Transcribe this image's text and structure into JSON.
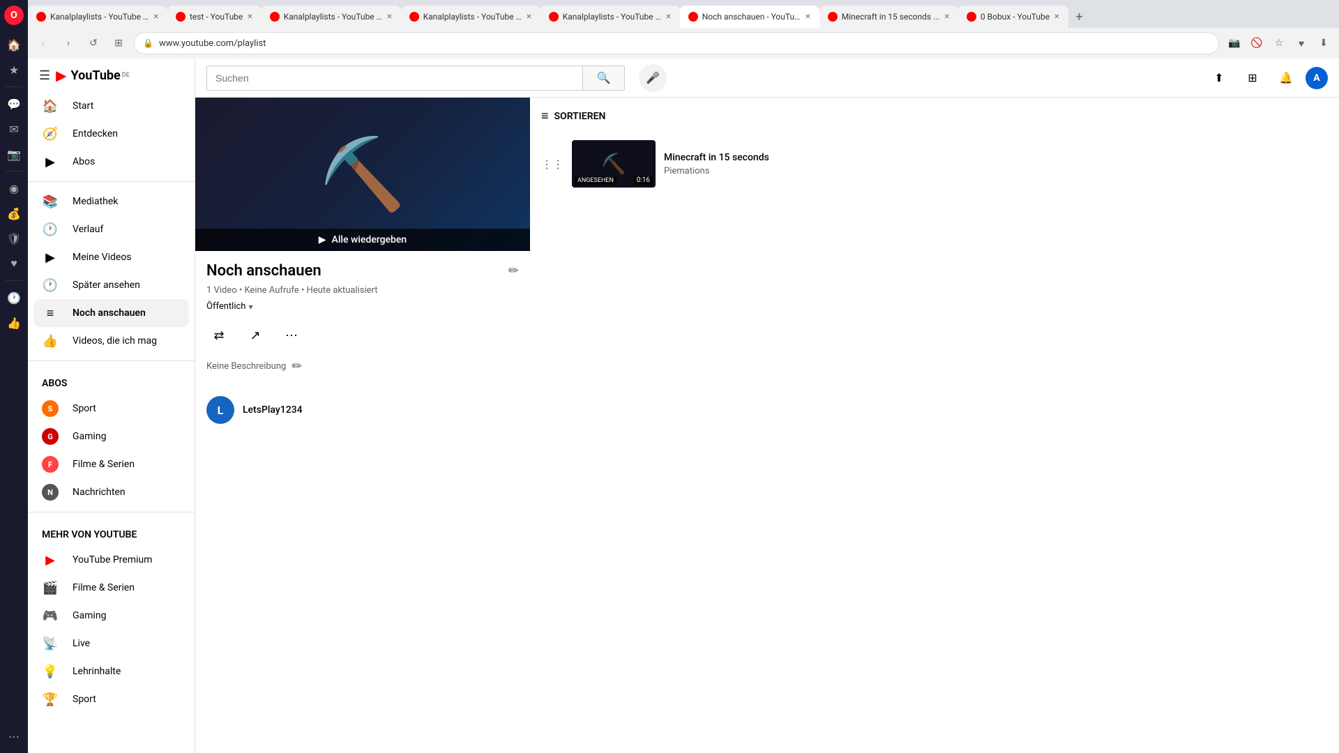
{
  "browser": {
    "tabs": [
      {
        "id": 1,
        "title": "Kanalplaylists - YouTube S...",
        "url": "youtube.com",
        "active": false,
        "favicon": "yt-red"
      },
      {
        "id": 2,
        "title": "test - YouTube",
        "url": "youtube.com",
        "active": false,
        "favicon": "yt-red"
      },
      {
        "id": 3,
        "title": "Kanalplaylists - YouTube S...",
        "url": "youtube.com",
        "active": false,
        "favicon": "yt-red"
      },
      {
        "id": 4,
        "title": "Kanalplaylists - YouTube S...",
        "url": "youtube.com",
        "active": false,
        "favicon": "yt-red"
      },
      {
        "id": 5,
        "title": "Kanalplaylists - YouTube S...",
        "url": "youtube.com",
        "active": false,
        "favicon": "yt-red"
      },
      {
        "id": 6,
        "title": "Noch anschauen - YouTube...",
        "url": "youtube.com",
        "active": true,
        "favicon": "yt-red"
      },
      {
        "id": 7,
        "title": "Minecraft in 15 seconds...",
        "url": "youtube.com",
        "active": false,
        "favicon": "yt-red"
      },
      {
        "id": 8,
        "title": "0 Bobux - YouTube",
        "url": "youtube.com",
        "active": false,
        "favicon": "yt-red"
      }
    ],
    "address": "www.youtube.com/playlist"
  },
  "youtube": {
    "logo_text": "YouTube",
    "logo_suffix": "DE",
    "search_placeholder": "Suchen",
    "sidebar": {
      "main_items": [
        {
          "id": "start",
          "label": "Start",
          "icon": "🏠"
        },
        {
          "id": "entdecken",
          "label": "Entdecken",
          "icon": "🧭"
        },
        {
          "id": "abos",
          "label": "Abos",
          "icon": "▶️"
        }
      ],
      "library_items": [
        {
          "id": "mediathek",
          "label": "Mediathek",
          "icon": "📚"
        },
        {
          "id": "verlauf",
          "label": "Verlauf",
          "icon": "🕐"
        },
        {
          "id": "meine-videos",
          "label": "Meine Videos",
          "icon": "▶"
        },
        {
          "id": "spaeter-ansehen",
          "label": "Später ansehen",
          "icon": "🕐"
        },
        {
          "id": "noch-anschauen",
          "label": "Noch anschauen",
          "icon": "≡",
          "active": true
        },
        {
          "id": "videos-ich-mag",
          "label": "Videos, die ich mag",
          "icon": "👍"
        }
      ],
      "abos_section_title": "ABOS",
      "abos_items": [
        {
          "id": "sport",
          "label": "Sport",
          "color": "#ff6b00"
        },
        {
          "id": "gaming",
          "label": "Gaming",
          "color": "#cc0000"
        },
        {
          "id": "filme-serien",
          "label": "Filme & Serien",
          "color": "#ff4444"
        },
        {
          "id": "nachrichten",
          "label": "Nachrichten",
          "color": "#444444"
        }
      ],
      "mehr_section_title": "MEHR VON YOUTUBE",
      "mehr_items": [
        {
          "id": "youtube-premium",
          "label": "YouTube Premium",
          "icon": "▶"
        },
        {
          "id": "filme-serien2",
          "label": "Filme & Serien",
          "icon": "🎬"
        },
        {
          "id": "gaming2",
          "label": "Gaming",
          "icon": "🎮"
        },
        {
          "id": "live",
          "label": "Live",
          "icon": "📻"
        },
        {
          "id": "lehrinhalte",
          "label": "Lehrinhalte",
          "icon": "💡"
        },
        {
          "id": "sport2",
          "label": "Sport",
          "icon": "🏆"
        }
      ]
    },
    "playlist": {
      "title": "Noch anschauen",
      "meta": "1 Video • Keine Aufrufe • Heute aktualisiert",
      "visibility": "Öffentlich",
      "description": "Keine Beschreibung",
      "play_all_label": "Alle wiedergeben",
      "channel": {
        "name": "LetsPlay1234",
        "avatar_letter": "L",
        "avatar_color": "#1565c0"
      }
    },
    "sort_label": "SORTIEREN",
    "videos": [
      {
        "id": 1,
        "title": "Minecraft in 15 seconds",
        "channel": "Piemations",
        "duration": "0:16",
        "watched": true,
        "watched_label": "ANGESEHEN"
      }
    ]
  }
}
